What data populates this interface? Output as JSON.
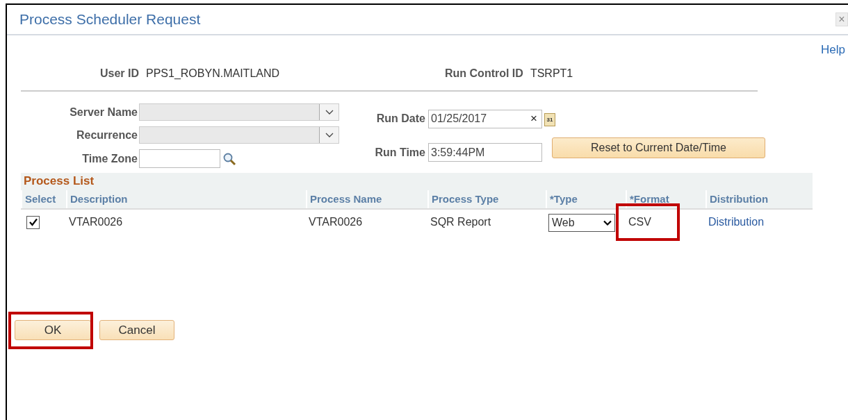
{
  "window": {
    "title": "Process Scheduler Request",
    "close": "×",
    "help": "Help"
  },
  "user_id": {
    "label": "User ID",
    "value": "PPS1_ROBYN.MAITLAND"
  },
  "run_control_id": {
    "label": "Run Control ID",
    "value": "TSRPT1"
  },
  "server_name": {
    "label": "Server Name",
    "disabled": true
  },
  "recurrence": {
    "label": "Recurrence",
    "disabled": true
  },
  "time_zone": {
    "label": "Time Zone"
  },
  "run_date": {
    "label": "Run Date",
    "value": "01/25/2017",
    "clear": "×",
    "calendar": "31"
  },
  "run_time": {
    "label": "Run Time",
    "value": "3:59:44PM"
  },
  "reset_button": "Reset to Current Date/Time",
  "process_list": {
    "title": "Process List",
    "columns": [
      "Select",
      "Description",
      "Process Name",
      "Process Type",
      "*Type",
      "*Format",
      "Distribution"
    ],
    "rows": [
      {
        "checked": true,
        "description": "VTAR0026",
        "process_name": "VTAR0026",
        "process_type": "SQR Report",
        "type": "Web",
        "format": "CSV",
        "format_highlighted": true,
        "distribution": "Distribution"
      }
    ]
  },
  "buttons": [
    {
      "label": "OK",
      "highlighted": true
    },
    {
      "label": "Cancel",
      "highlighted": false
    }
  ]
}
